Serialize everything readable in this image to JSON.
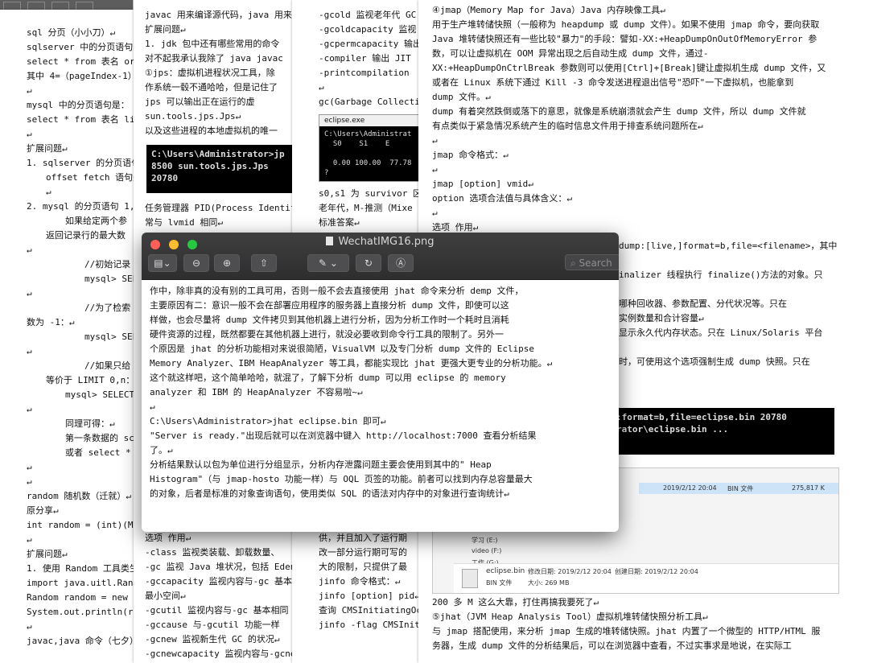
{
  "colors": {
    "close": "#ff5f57",
    "minimize": "#febc2e",
    "zoom": "#28c840",
    "cmd_bg": "#000000"
  },
  "doc1": {
    "lines": [
      {
        "t": "sql 分页（小小刀）↵"
      },
      {
        "t": "sqlserver 中的分页语句"
      },
      {
        "t": "select * from 表名 orc"
      },
      {
        "t": "其中 4=（pageIndex-1）"
      },
      {
        "t": "↵"
      },
      {
        "t": "mysql 中的分页语句是："
      },
      {
        "t": "select * from 表名 lir"
      },
      {
        "t": "↵"
      },
      {
        "t": "扩展问题↵"
      },
      {
        "t": "1.  sqlserver 的分页语句"
      },
      {
        "t": "offset fetch 语句是",
        "i": 1
      },
      {
        "t": "↵",
        "i": 1
      },
      {
        "t": "2.  mysql 的分页语句 1,"
      },
      {
        "t": "如果给定两个参",
        "i": 2
      },
      {
        "t": "返回记录行的最大数",
        "i": 1
      },
      {
        "t": "↵"
      },
      {
        "t": "//初始记录",
        "i": 3
      },
      {
        "t": "mysql> SELE",
        "i": 3
      },
      {
        "t": "↵"
      },
      {
        "t": "//为了检索",
        "i": 3
      },
      {
        "t": "数为 -1：↵"
      },
      {
        "t": "mysql> SEL",
        "i": 3
      },
      {
        "t": "↵"
      },
      {
        "t": "//如果只给",
        "i": 3
      },
      {
        "t": "等价于 LIMIT 0,n：",
        "i": 1
      },
      {
        "t": "mysql> SELECT",
        "i": 2
      },
      {
        "t": "↵"
      },
      {
        "t": "同理可得：↵",
        "i": 2
      },
      {
        "t": "第一条数据的 sc",
        "i": 2
      },
      {
        "t": "或者 select *",
        "i": 2
      },
      {
        "t": "↵"
      },
      {
        "t": "↵"
      },
      {
        "t": "random 随机数（迁就）↵"
      },
      {
        "t": "原分享↵"
      },
      {
        "t": "int random = (int)(Mat"
      },
      {
        "t": "↵"
      },
      {
        "t": "扩展问题↵"
      },
      {
        "t": "1. 使用 Random 工具类生"
      },
      {
        "t": "import java.uitl.Rando"
      },
      {
        "t": "Random random = new Ra"
      },
      {
        "t": "System.out.println(ran"
      },
      {
        "t": "↵"
      },
      {
        "t": "javac,java 命令（七夕）"
      }
    ]
  },
  "doc2": {
    "lines_top": [
      "javac 用来编译源代码，java 用来",
      "扩展问题↵",
      "1.  jdk 包中还有哪些常用的命令",
      "对不起我承认我除了 java javac",
      "①jps：虚拟机进程状况工具，除",
      "作系统一毂不通哈哈，但是记住了",
      "jps 可以输出正在运行的虚",
      "sun.tools.jps.Jps↵",
      "以及这些进程的本地虚拟机的唯一"
    ],
    "cmd": "C:\\Users\\Administrator>jp\n8500 sun.tools.jps.Jps\n20780",
    "lines_bottom": [
      "任务管理器 PID(Process Identif",
      "常与 lvmid 相同↵"
    ],
    "lines_below": [
      "选项    作用↵",
      "-class  监视类装载、卸载数量、",
      "-gc 监视 Java 堆状况，包括 Eden",
      "-gccapacity 监视内容与-gc 基本",
      "最小空间↵",
      "-gcutil 监视内容与-gc 基本相同",
      "-gccause    与-gcutil 功能一样",
      "-gcnew 监视新生代 GC 的状况↵",
      "-gcnewcapacity  监视内容与-gcne"
    ]
  },
  "doc3": {
    "lines_top": [
      "-gcold  监视老年代 GC",
      "-gcoldcapacity  监视",
      "-gcpermcapacity 输出",
      "-compiler   输出 JIT",
      "-printcompilation",
      "↵",
      "gc(Garbage Collectio"
    ],
    "cmd_title": "eclipse.exe",
    "cmd": "C:\\Users\\Administrat\n  S0    S1    E\n\n  0.00 100.00  77.78\n?",
    "lines_bottom": [
      "s0,s1 为 survivor 区，",
      "老年代，M-推测（Mixe",
      "标准答案↵"
    ],
    "lines_below": [
      "供，并且加入了运行期",
      "改一部分运行期可写的",
      "大的限制，只提供了最",
      "jinfo 命令格式：↵",
      "jinfo [option] pid↵",
      "查询 CMSInitiatingOcc",
      "jinfo -flag CMSIniti"
    ]
  },
  "doc4": {
    "lines_top": [
      "④jmap（Memory Map for Java）Java 内存映像工具↵",
      "用于生产堆转储快照（一般称为 heapdump 或 dump 文件）。如果不使用 jmap 命令，要向获取",
      "Java 堆转储快照还有一些比较\"暴力\"的手段：譬如-XX:+HeapDumpOnOutOfMemoryError 参",
      "数，可以让虚拟机在 OOM 异常出现之后自动生成 dump 文件，通过-",
      "XX:+HeapDumpOnCtrlBreak 参数则可以使用[Ctrl]+[Break]键让虚拟机生成 dump 文件，又",
      "或者在 Linux 系统下通过 Kill -3 命令发送进程退出信号\"恐吓\"一下虚拟机，也能拿到",
      "dump 文件。↵",
      "dump 有着突然跌倒或落下的意思，就像是系统崩溃就会产生 dump 文件，所以 dump 文件就",
      "有点类似于紧急情况系统产生的临时信息文件用于排查系统问题所在↵",
      "↵",
      "jmap 命令格式：↵",
      "↵",
      "jmap [option] vmid↵",
      "option 选项合法值与具体含义：↵",
      "↵",
      "选项    作用↵"
    ],
    "lines_right": [
      "dump:[live,]format=b,file=<filename>，其中",
      "",
      "inalizer 线程执行 finalize()方法的对象。只",
      "",
      "哪种回收器、参数配置、分代状况等。只在",
      "实例数量和合计容量↵",
      "显示永久代内存状态。只在 Linux/Solaris 平台",
      "",
      "时，可使用这个选项强制生成 dump 快照。只在"
    ],
    "cmd": ":format=b,file=eclipse.bin 20780\nrator\\eclipse.bin ...",
    "lines_bottom": [
      "200 多 M 这么大靠，打住再搞我要死了↵",
      "⑤jhat（JVM Heap Analysis Tool）虚拟机堆转储快照分析工具↵",
      "与 jmap 搭配使用，来分析 jmap 生成的堆转储快照。jhat 内置了一个微型的 HTTP/HTML 服",
      "务器，生成 dump 文件的分析结果后，可以在浏览器中查看，不过实事求是地说，在实际工"
    ]
  },
  "explorer": {
    "row1_date": "2019/2/12 20:04",
    "row1_type": "BIN 文件",
    "row1_size": "275,817 K",
    "drive1": "学习 (E:)",
    "drive2": "video (F:)",
    "drive3": "工作 (G:)",
    "file_name": "eclipse.bin",
    "file_meta1": "修改日期: 2019/2/12 20:04",
    "file_meta2": "创建日期: 2019/2/12 20:04",
    "file_type": "BIN 文件",
    "file_size": "大小: 269 MB"
  },
  "viewer": {
    "title": "WechatIMG16.png",
    "search_placeholder": "Search",
    "lines": [
      "作中，除非真的没有别的工具可用，否则一般不会去直接使用 jhat 命令来分析 demp 文件，",
      "主要原因有二：意识一般不会在部署应用程序的服务器上直接分析 dump 文件，即使可以这",
      "样做，也会尽量将 dump 文件拷贝到其他机器上进行分析，因为分析工作时一个耗时且消耗",
      "硬件资源的过程，既然都要在其他机器上进行，就没必要收到命令行工具的限制了。另外一",
      "个原因是 jhat 的分析功能相对来说很简陋，VisualVM 以及专门分析 dump 文件的 Eclipse",
      "Memory Analyzer、IBM HeapAnalyzer 等工具，都能实现比 jhat 更强大更专业的分析功能。↵",
      "这个就这样吧，这个简单哈哈，就混了，了解下分析 dump 可以用 eclipse 的 memory",
      "analyzer 和 IBM 的 HeapAnalyzer 不容易啦~↵",
      "↵",
      "C:\\Users\\Administrator>jhat eclipse.bin 即可↵",
      "\"Server is ready.\"出现后就可以在浏览器中键入 http://localhost:7000 查看分析结果",
      "了。↵",
      "分析结果默认以包为单位进行分组显示，分析内存泄露问题主要会使用到其中的\" Heap",
      "Histogram\"（与 jmap-hosto 功能一样）与 OQL 页签的功能。前者可以找到内存总容量最大",
      "的对象，后者是标准的对象查询语句，使用类似 SQL 的语法对内存中的对象进行查询统计↵"
    ]
  }
}
